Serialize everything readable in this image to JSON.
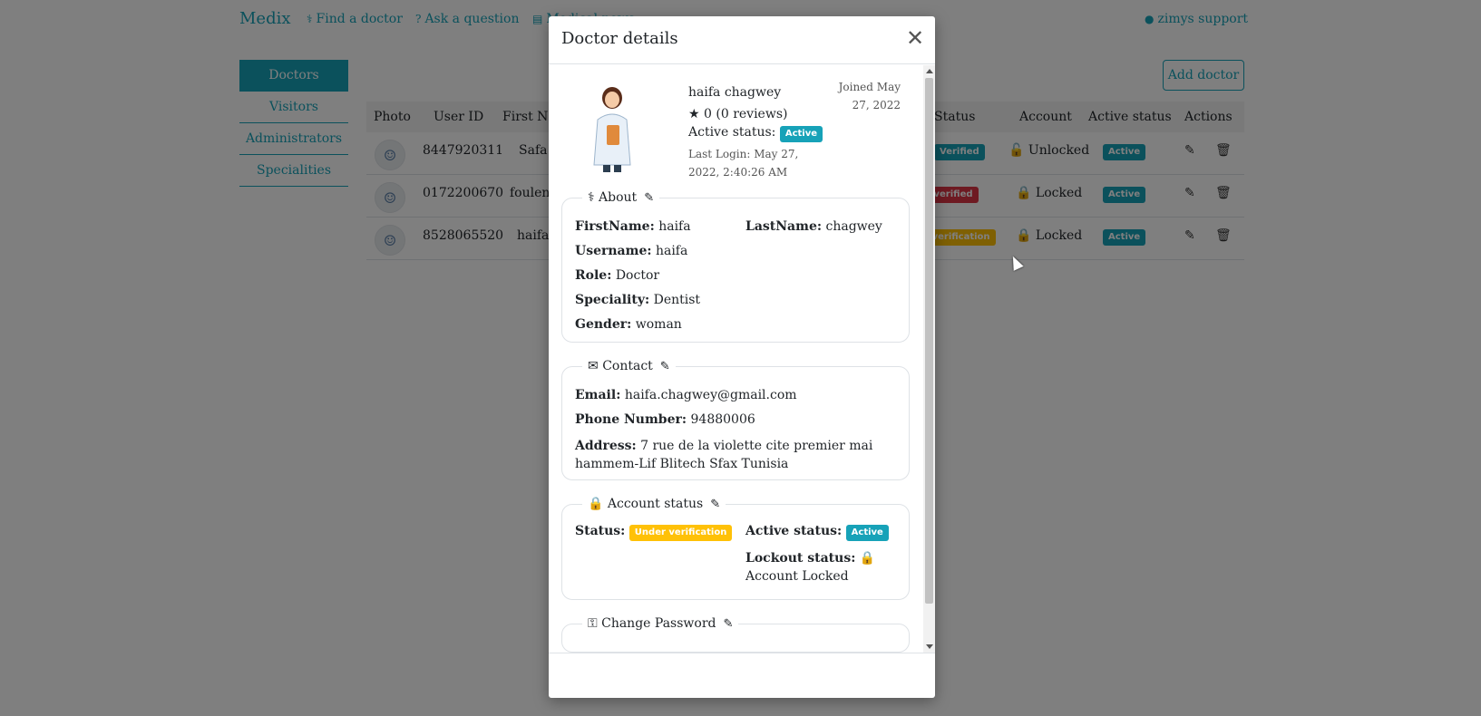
{
  "nav": {
    "brand": "Medix",
    "links": [
      {
        "icon": "user-md-icon",
        "glyph": "⚕",
        "label": "Find a doctor"
      },
      {
        "icon": "question-circle-icon",
        "glyph": "?",
        "label": "Ask a question"
      },
      {
        "icon": "newspaper-icon",
        "glyph": "▤",
        "label": "Medical news"
      }
    ],
    "user": {
      "icon": "user-icon",
      "glyph": "●",
      "label": "zimys support"
    }
  },
  "sidebar": {
    "items": [
      {
        "label": "Doctors",
        "active": true
      },
      {
        "label": "Visitors",
        "active": false
      },
      {
        "label": "Administrators",
        "active": false
      },
      {
        "label": "Specialities",
        "active": false
      }
    ]
  },
  "toolbar": {
    "add_doctor_label": "Add doctor"
  },
  "table": {
    "headers": [
      "Photo",
      "User ID",
      "First Name",
      "Status",
      "Account",
      "Active status",
      "Actions"
    ],
    "rows": [
      {
        "user_id": "8447920311",
        "first_name": "Safa",
        "status": "Verified",
        "status_color": "#17a2b8",
        "account": "Unlocked",
        "account_locked": false,
        "active": "Active"
      },
      {
        "user_id": "0172200670",
        "first_name": "foulen",
        "status": "Not verified",
        "status_color": "#dc3545",
        "account": "Locked",
        "account_locked": true,
        "active": "Active"
      },
      {
        "user_id": "8528065520",
        "first_name": "haifa",
        "status": "Under verification",
        "status_color": "#ffc107",
        "account": "Locked",
        "account_locked": true,
        "active": "Active"
      }
    ]
  },
  "modal": {
    "title": "Doctor details",
    "close_icon": "close-icon",
    "profile": {
      "name": "haifa chagwey",
      "reviews": "0 (0 reviews)",
      "active_status_label": "Active status:",
      "active_status": "Active",
      "last_login": "Last Login: May 27, 2022, 2:40:26 AM",
      "joined": "Joined May 27, 2022"
    },
    "about": {
      "legend": "About",
      "firstname_label": "FirstName:",
      "firstname": "haifa",
      "lastname_label": "LastName:",
      "lastname": "chagwey",
      "username_label": "Username:",
      "username": "haifa",
      "role_label": "Role:",
      "role": "Doctor",
      "speciality_label": "Speciality:",
      "speciality": "Dentist",
      "gender_label": "Gender:",
      "gender": "woman"
    },
    "contact": {
      "legend": "Contact",
      "email_label": "Email:",
      "email": "haifa.chagwey@gmail.com",
      "phone_label": "Phone Number:",
      "phone": "94880006",
      "address_label": "Address:",
      "address": "7 rue de la violette cite premier mai hammem-Lif Blitech Sfax Tunisia"
    },
    "account_status": {
      "legend": "Account status",
      "status_label": "Status:",
      "status": "Under verification",
      "active_label": "Active status:",
      "active": "Active",
      "lockout_label": "Lockout status:",
      "lockout": "Account Locked"
    },
    "change_password": {
      "legend": "Change Password"
    }
  },
  "colors": {
    "accent": "#17a2b8",
    "danger": "#dc3545",
    "warning": "#ffc107"
  }
}
